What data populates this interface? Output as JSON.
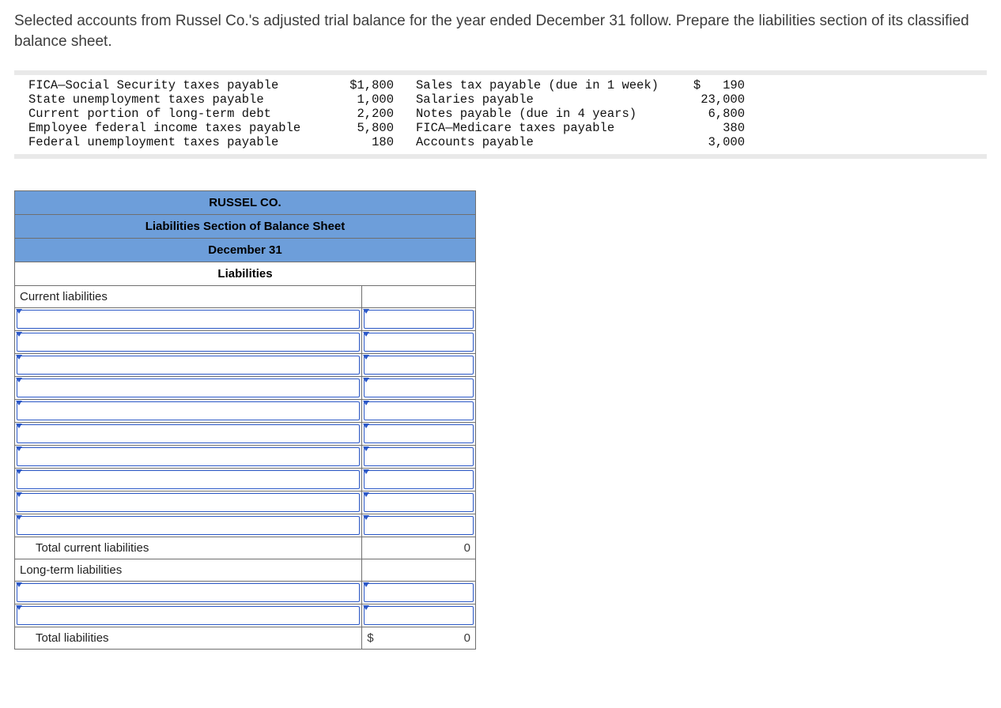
{
  "intro": "Selected accounts from Russel Co.'s adjusted trial balance for the year ended December 31 follow. Prepare the liabilities section of its classified balance sheet.",
  "data_rows": [
    {
      "l1": "FICA—Social Security taxes payable",
      "a1": "$1,800",
      "l2": "Sales tax payable (due in 1 week)",
      "a2": "$   190"
    },
    {
      "l1": "State unemployment taxes payable",
      "a1": "1,000",
      "l2": "Salaries payable",
      "a2": "23,000"
    },
    {
      "l1": "Current portion of long-term debt",
      "a1": "2,200",
      "l2": "Notes payable (due in 4 years)",
      "a2": "6,800"
    },
    {
      "l1": "Employee federal income taxes payable",
      "a1": "5,800",
      "l2": "FICA—Medicare taxes payable",
      "a2": "380"
    },
    {
      "l1": "Federal unemployment taxes payable",
      "a1": "180",
      "l2": "Accounts payable",
      "a2": "3,000"
    }
  ],
  "sheet": {
    "h1": "RUSSEL CO.",
    "h2": "Liabilities Section of Balance Sheet",
    "h3": "December 31",
    "h4": "Liabilities",
    "current_label": "Current liabilities",
    "total_current_label": "Total current liabilities",
    "total_current_value": "0",
    "longterm_label": "Long-term liabilities",
    "total_label": "Total liabilities",
    "total_currency": "$",
    "total_value": "0"
  }
}
